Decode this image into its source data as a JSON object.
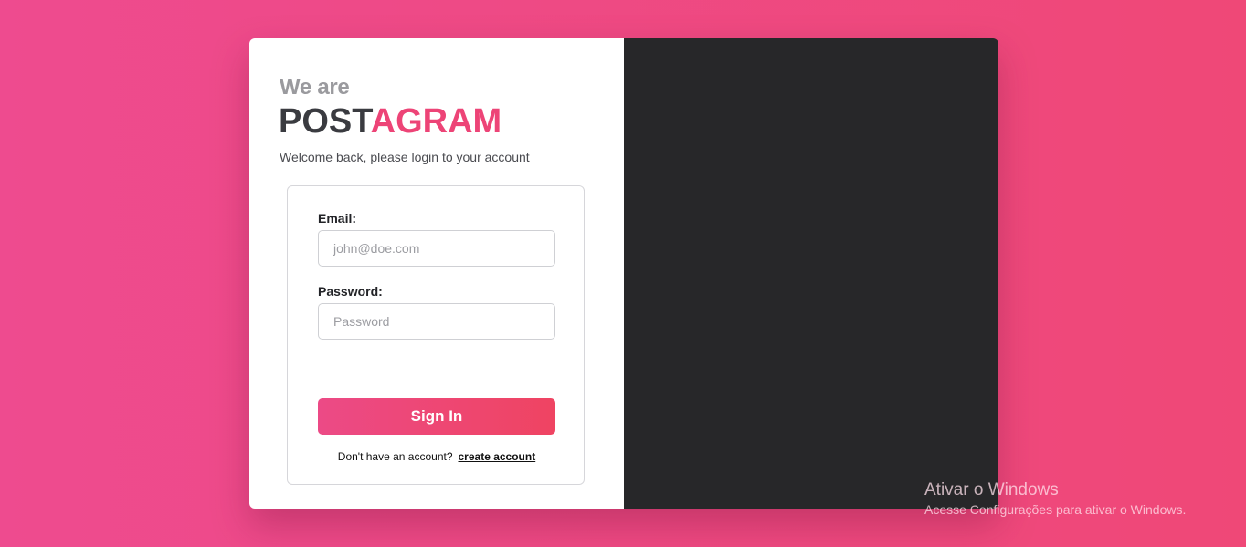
{
  "brand": {
    "intro": "We are",
    "name_part1": "POST",
    "name_part2": "AGRAM",
    "accent_color": "#ed4477",
    "dark_color": "#3a3b40"
  },
  "subtitle": "Welcome back, please login to your account",
  "form": {
    "email_label": "Email:",
    "email_placeholder": "john@doe.com",
    "email_value": "",
    "password_label": "Password:",
    "password_placeholder": "Password",
    "password_value": "",
    "submit_label": "Sign In",
    "footer_text": "Don't have an account?",
    "create_account_label": "create account"
  },
  "watermark": {
    "title": "Ativar o Windows",
    "subtitle": "Acesse Configurações para ativar o Windows."
  },
  "colors": {
    "background_start": "#ee4b8f",
    "background_end": "#ef4877",
    "right_panel": "#272729"
  }
}
